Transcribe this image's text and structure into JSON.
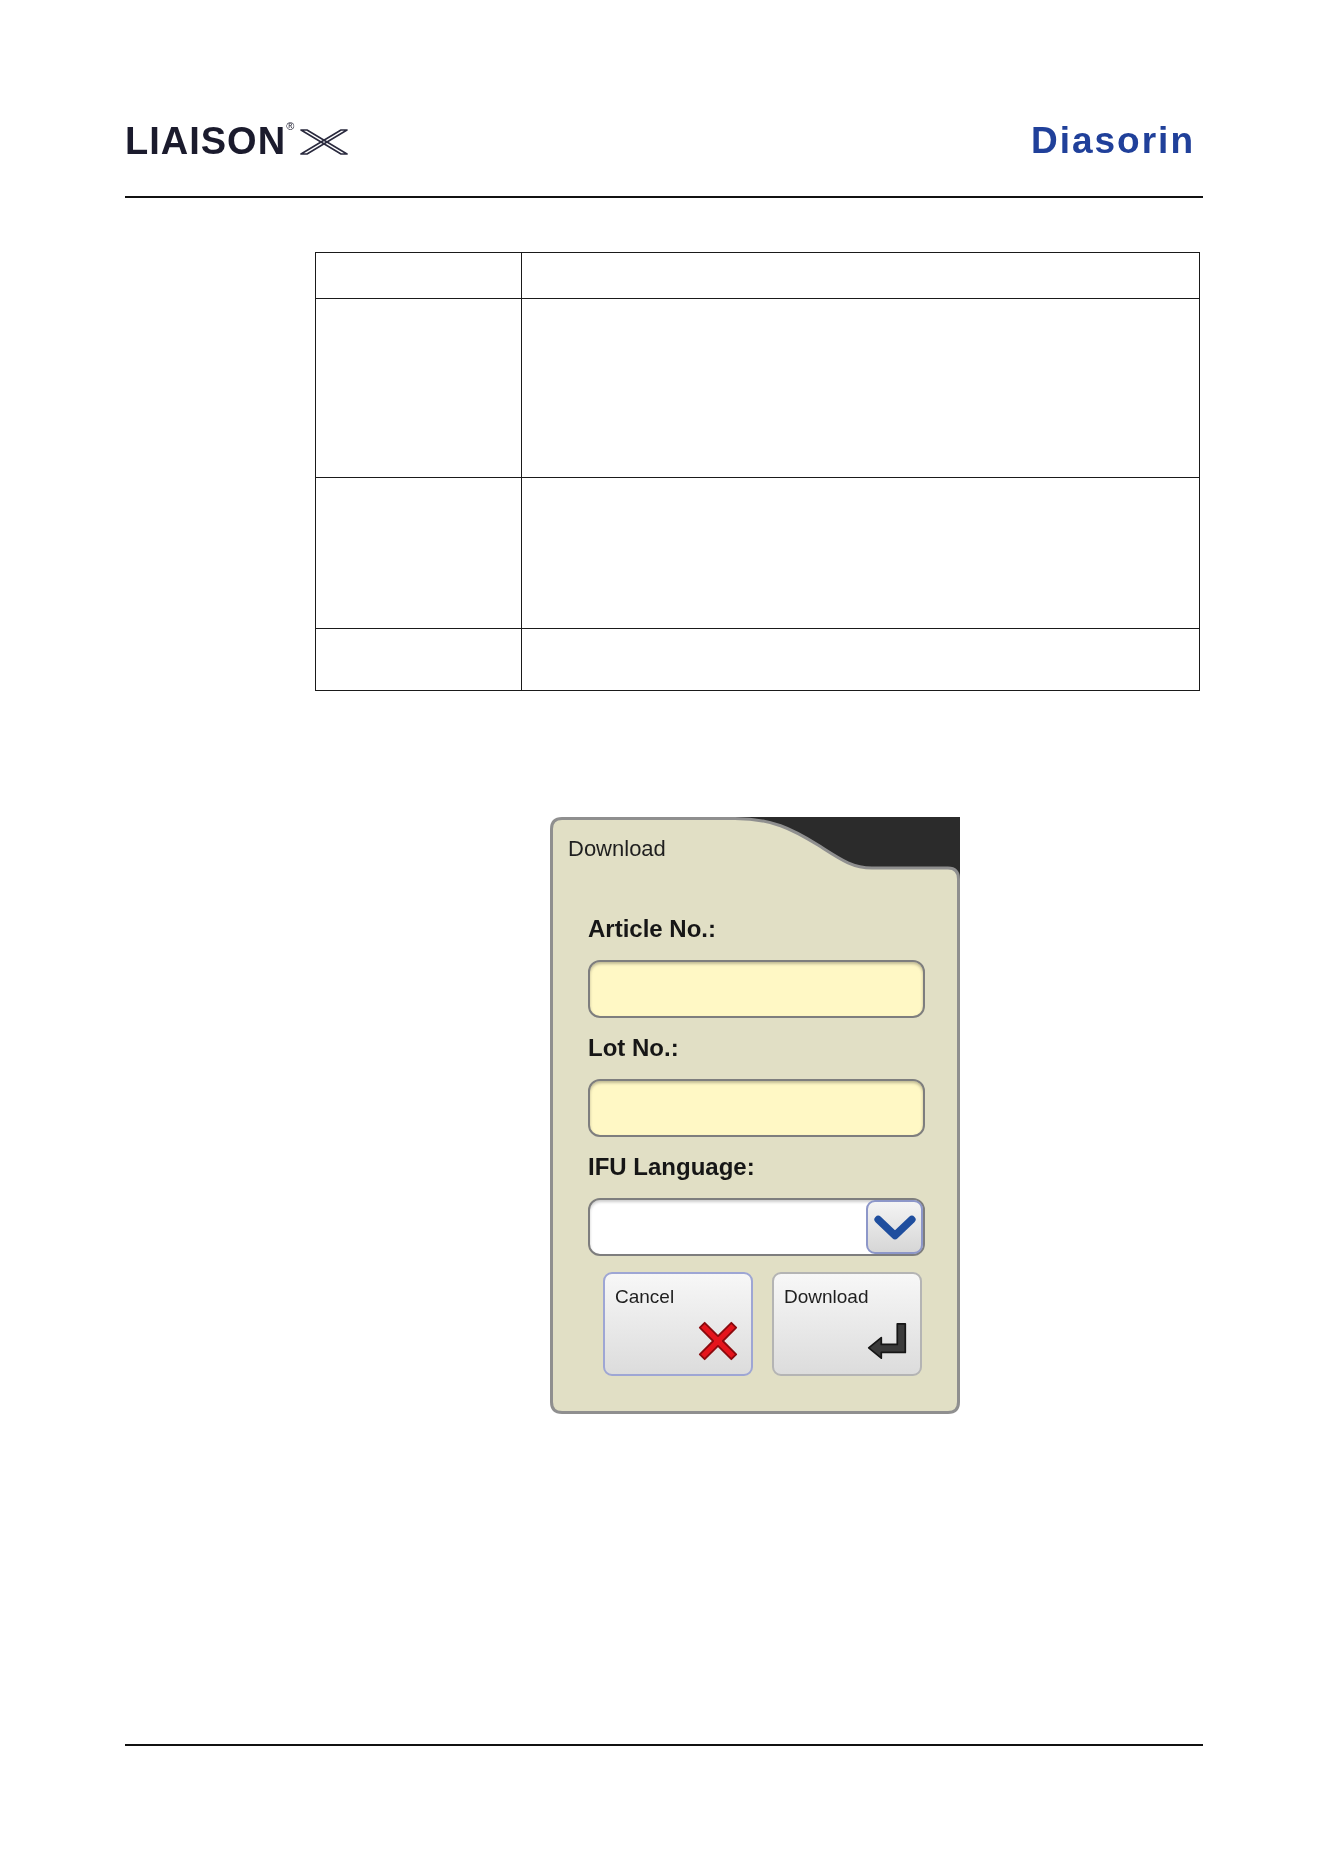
{
  "header": {
    "product_logo": "LIAISON$^{®}$",
    "company_logo": "Diasorin"
  },
  "dialog": {
    "title": "Download",
    "fields": [
      {
        "kind": "text",
        "label": "Article No.:"
      },
      {
        "kind": "text",
        "label": "Lot No.:"
      },
      {
        "kind": "dropdown",
        "label": "IFU Language:"
      }
    ],
    "buttons": [
      {
        "kind": "cancel",
        "label": "Cancel",
        "focused": true
      },
      {
        "kind": "confirm",
        "label": "Download",
        "focused": false
      }
    ]
  }
}
